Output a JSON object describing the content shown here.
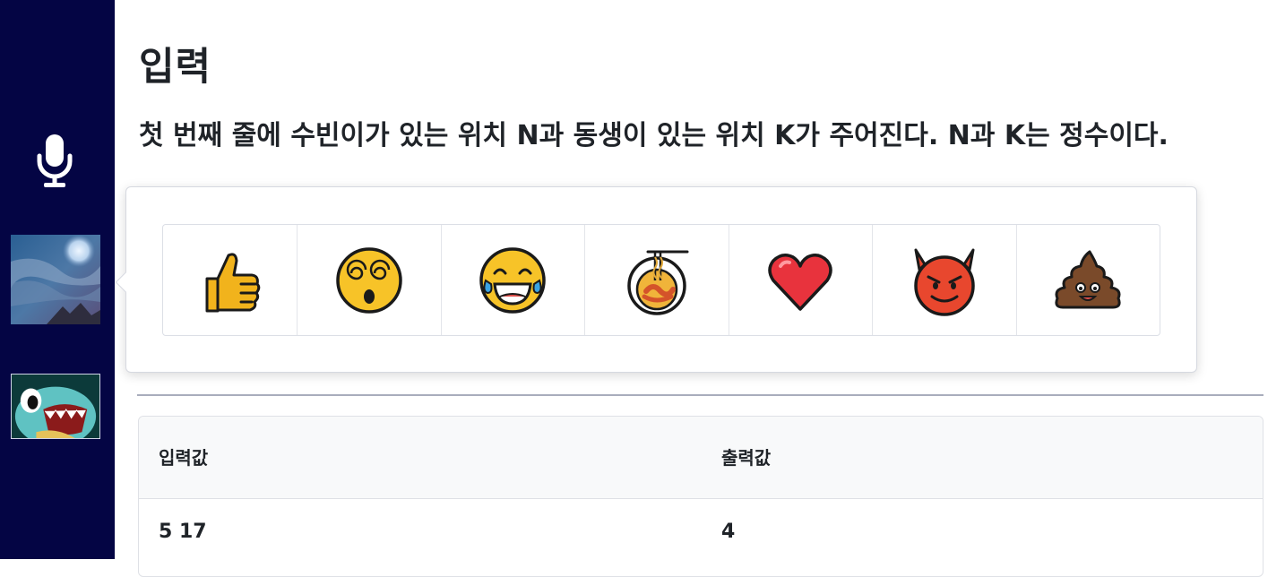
{
  "sidebar": {
    "mic_icon": "microphone-icon",
    "avatars": [
      "avatar-night-sky",
      "avatar-squirtle"
    ]
  },
  "section": {
    "title": "입력",
    "description": "첫 번째 줄에 수빈이가 있는 위치 N과 동생이 있는 위치 K가 주어진다. N과 K는 정수이다."
  },
  "table": {
    "headers": [
      "입력값",
      "출력값"
    ],
    "rows": [
      [
        "5 17",
        "4"
      ]
    ]
  },
  "reactions": {
    "items": [
      "thumbs-up-icon",
      "dizzy-face-icon",
      "tears-of-joy-icon",
      "noodle-bowl-icon",
      "heart-icon",
      "smiling-devil-icon",
      "poop-icon"
    ]
  }
}
